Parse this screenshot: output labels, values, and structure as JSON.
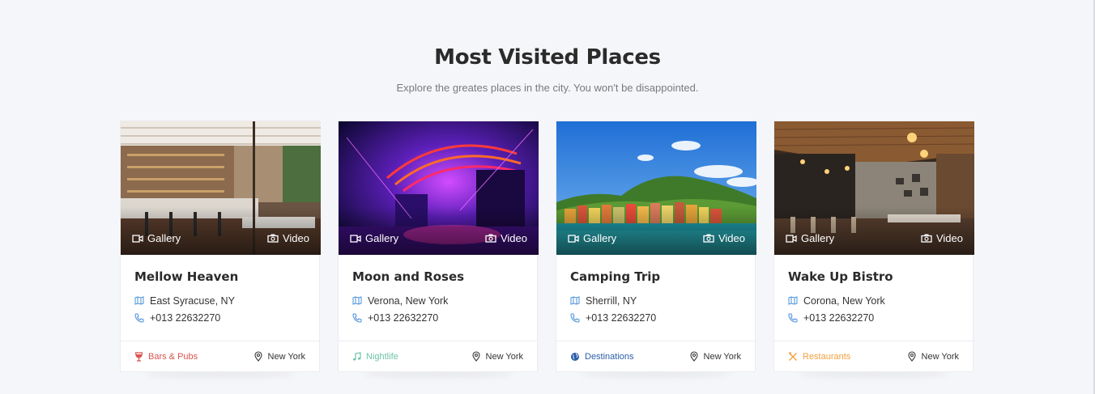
{
  "section": {
    "title": "Most Visited Places",
    "subtitle": "Explore the greates places in the city. You won't be disappointed."
  },
  "cards": [
    {
      "title": "Mellow Heaven",
      "gallery_label": "Gallery",
      "video_label": "Video",
      "address": "East Syracuse, NY",
      "phone": "+013 22632270",
      "category": "Bars & Pubs",
      "category_icon": "wine-glass-icon",
      "category_color": "#d9534f",
      "city": "New York"
    },
    {
      "title": "Moon and Roses",
      "gallery_label": "Gallery",
      "video_label": "Video",
      "address": "Verona, New York",
      "phone": "+013 22632270",
      "category": "Nightlife",
      "category_icon": "music-note-icon",
      "category_color": "#6fc3a8",
      "city": "New York"
    },
    {
      "title": "Camping Trip",
      "gallery_label": "Gallery",
      "video_label": "Video",
      "address": "Sherrill, NY",
      "phone": "+013 22632270",
      "category": "Destinations",
      "category_icon": "globe-icon",
      "category_color": "#2a5ea8",
      "city": "New York"
    },
    {
      "title": "Wake Up Bistro",
      "gallery_label": "Gallery",
      "video_label": "Video",
      "address": "Corona, New York",
      "phone": "+013 22632270",
      "category": "Restaurants",
      "category_icon": "fork-knife-icon",
      "category_color": "#f2a03d",
      "city": "New York"
    }
  ],
  "colors": {
    "background": "#f5f6fa",
    "info_icon": "#4a90d9"
  }
}
